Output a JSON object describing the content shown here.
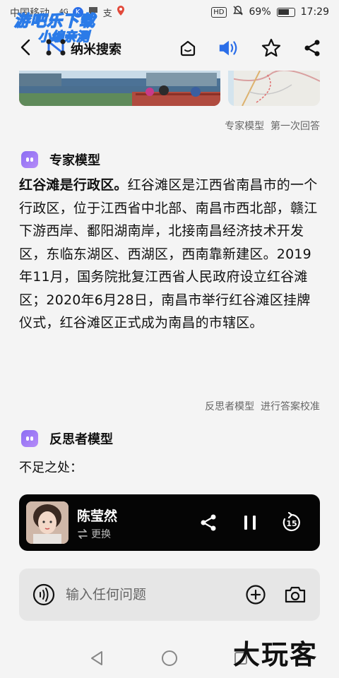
{
  "status_bar": {
    "carrier": "中国移动",
    "network": "4G",
    "battery": "69%",
    "time": "17:29",
    "hd": "HD",
    "watermark_line1": "游吧乐下载",
    "watermark_line2": "小编亲测"
  },
  "app": {
    "title": "纳米搜索"
  },
  "expert": {
    "meta_model": "专家模型",
    "meta_round": "第一次回答",
    "title": "专家模型",
    "answer_bold": "红谷滩是行政区。",
    "answer_rest": "红谷滩区是江西省南昌市的一个行政区，位于江西省中北部、南昌市西北部，赣江下游西岸、鄱阳湖南岸，北接南昌经济技术开发区，东临东湖区、西湖区，西南靠新建区。2019年11月，国务院批复江西省人民政府设立红谷滩区；2020年6月28日，南昌市举行红谷滩区挂牌仪式，红谷滩区正式成为南昌的市辖区。"
  },
  "reflector": {
    "meta_model": "反思者模型",
    "meta_action": "进行答案校准",
    "title": "反思者模型",
    "subheading": "不足之处："
  },
  "player": {
    "voice_name": "陈莹然",
    "switch_label": "更换",
    "replay_seconds": "15"
  },
  "input": {
    "placeholder": "输入任何问题"
  },
  "corner_logo": "大玩客",
  "colors": {
    "accent_blue": "#2b6ee8",
    "bot_purple": "#8b6df3",
    "player_bg": "#050505"
  }
}
